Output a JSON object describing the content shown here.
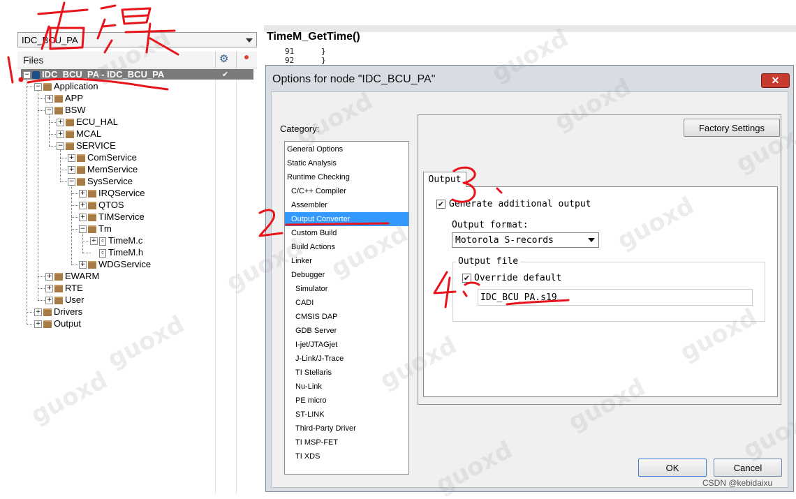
{
  "workspace": {
    "dropdown_value": "IDC_BCU_PA",
    "files_header": "Files",
    "tree": [
      {
        "label": "IDC_BCU_PA - IDC_BCU_PA",
        "depth": 0,
        "type": "project",
        "toggle": "⊟",
        "selected": true,
        "check": "✔"
      },
      {
        "label": "Application",
        "depth": 1,
        "type": "folder",
        "toggle": "⊟"
      },
      {
        "label": "APP",
        "depth": 2,
        "type": "folder",
        "toggle": "⊞"
      },
      {
        "label": "BSW",
        "depth": 2,
        "type": "folder",
        "toggle": "⊟"
      },
      {
        "label": "ECU_HAL",
        "depth": 3,
        "type": "folder",
        "toggle": "⊞"
      },
      {
        "label": "MCAL",
        "depth": 3,
        "type": "folder",
        "toggle": "⊞"
      },
      {
        "label": "SERVICE",
        "depth": 3,
        "type": "folder",
        "toggle": "⊟"
      },
      {
        "label": "ComService",
        "depth": 4,
        "type": "folder",
        "toggle": "⊞"
      },
      {
        "label": "MemService",
        "depth": 4,
        "type": "folder",
        "toggle": "⊞"
      },
      {
        "label": "SysService",
        "depth": 4,
        "type": "folder",
        "toggle": "⊟"
      },
      {
        "label": "IRQService",
        "depth": 5,
        "type": "folder",
        "toggle": "⊞"
      },
      {
        "label": "QTOS",
        "depth": 5,
        "type": "folder",
        "toggle": "⊞"
      },
      {
        "label": "TIMService",
        "depth": 5,
        "type": "folder",
        "toggle": "⊞"
      },
      {
        "label": "Tm",
        "depth": 5,
        "type": "folder",
        "toggle": "⊟"
      },
      {
        "label": "TimeM.c",
        "depth": 6,
        "type": "file",
        "toggle": "⊞"
      },
      {
        "label": "TimeM.h",
        "depth": 6,
        "type": "file",
        "toggle": ""
      },
      {
        "label": "WDGService",
        "depth": 5,
        "type": "folder",
        "toggle": "⊞"
      },
      {
        "label": "EWARM",
        "depth": 2,
        "type": "folder",
        "toggle": "⊞"
      },
      {
        "label": "RTE",
        "depth": 2,
        "type": "folder",
        "toggle": "⊞"
      },
      {
        "label": "User",
        "depth": 2,
        "type": "folder",
        "toggle": "⊞"
      },
      {
        "label": "Drivers",
        "depth": 1,
        "type": "folder",
        "toggle": "⊞"
      },
      {
        "label": "Output",
        "depth": 1,
        "type": "folder",
        "toggle": "⊞"
      }
    ]
  },
  "editor": {
    "title": "TimeM_GetTime()",
    "lines": [
      {
        "num": "91",
        "code": "}"
      },
      {
        "num": "92",
        "code": "}"
      }
    ]
  },
  "dialog": {
    "title": "Options for node \"IDC_BCU_PA\"",
    "close_label": "✕",
    "category_label": "Category:",
    "categories": [
      {
        "label": "General Options",
        "indent": 0
      },
      {
        "label": "Static Analysis",
        "indent": 0
      },
      {
        "label": "Runtime Checking",
        "indent": 0
      },
      {
        "label": "C/C++ Compiler",
        "indent": 1
      },
      {
        "label": "Assembler",
        "indent": 1
      },
      {
        "label": "Output Converter",
        "indent": 1,
        "selected": true
      },
      {
        "label": "Custom Build",
        "indent": 1
      },
      {
        "label": "Build Actions",
        "indent": 1
      },
      {
        "label": "Linker",
        "indent": 1
      },
      {
        "label": "Debugger",
        "indent": 1
      },
      {
        "label": "Simulator",
        "indent": 2
      },
      {
        "label": "CADI",
        "indent": 2
      },
      {
        "label": "CMSIS DAP",
        "indent": 2
      },
      {
        "label": "GDB Server",
        "indent": 2
      },
      {
        "label": "I-jet/JTAGjet",
        "indent": 2
      },
      {
        "label": "J-Link/J-Trace",
        "indent": 2
      },
      {
        "label": "TI Stellaris",
        "indent": 2
      },
      {
        "label": "Nu-Link",
        "indent": 2
      },
      {
        "label": "PE micro",
        "indent": 2
      },
      {
        "label": "ST-LINK",
        "indent": 2
      },
      {
        "label": "Third-Party Driver",
        "indent": 2
      },
      {
        "label": "TI MSP-FET",
        "indent": 2
      },
      {
        "label": "TI XDS",
        "indent": 2
      }
    ],
    "factory_settings_label": "Factory Settings",
    "tab_label": "Output",
    "generate_label": "Generate additional output",
    "generate_checked": true,
    "format_label": "Output format:",
    "format_value": "Motorola S-records",
    "output_file_group": "Output file",
    "override_label": "Override default",
    "override_checked": true,
    "output_file_value": "IDC_BCU_PA.s19",
    "ok_label": "OK",
    "cancel_label": "Cancel"
  },
  "watermark": "guoxd",
  "footer_credit": "CSDN @kebidaixu",
  "annotations": {
    "color": "#e8141c",
    "handwritten": [
      "1.",
      "2.",
      "3.",
      "4.",
      "右键"
    ]
  }
}
